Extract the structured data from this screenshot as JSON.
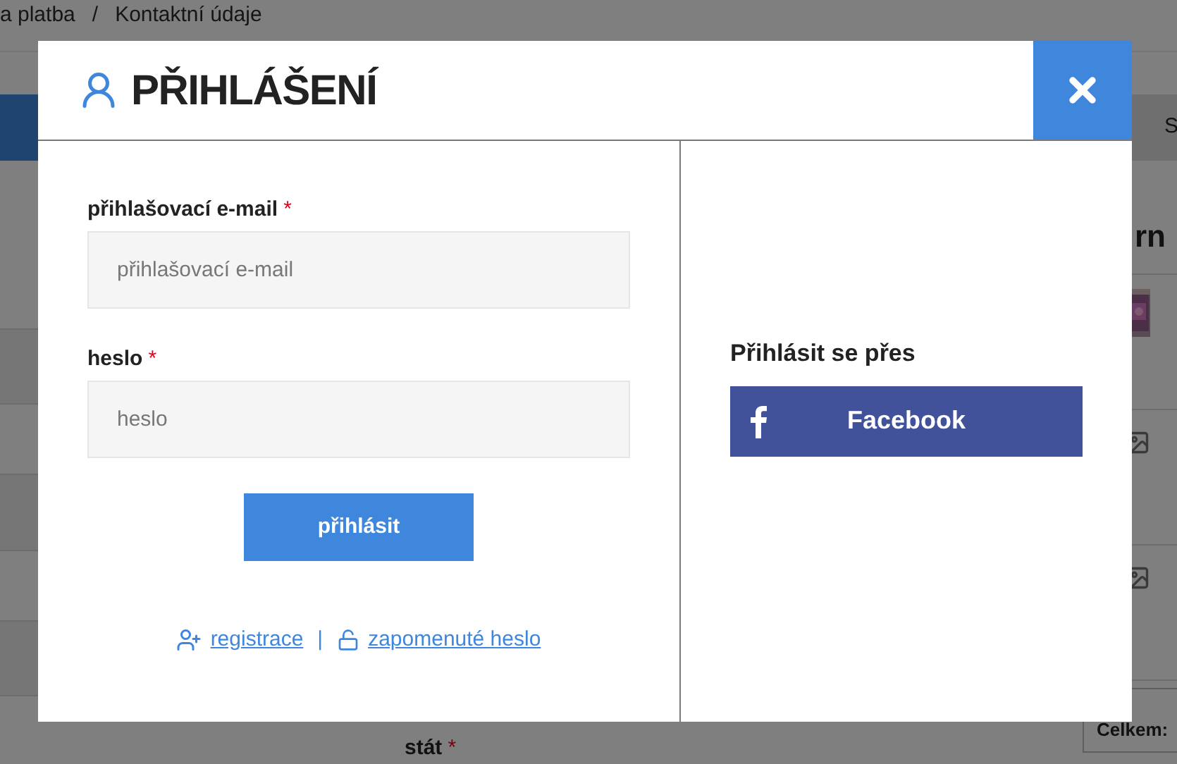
{
  "breadcrumb": {
    "items": [
      "a platba",
      "Kontaktní údaje"
    ],
    "separator": "/"
  },
  "background": {
    "tab_label": "S",
    "heading": "rn",
    "thumbnails": [
      {
        "kind": "picture"
      },
      {
        "kind": "placeholder"
      },
      {
        "kind": "placeholder"
      }
    ],
    "total_label": "Celkem:",
    "field": {
      "label": "stát",
      "required": true
    }
  },
  "modal": {
    "title": "PŘIHLÁŠENÍ",
    "required_mark": "*",
    "fields": [
      {
        "label": "přihlašovací e-mail",
        "required": true,
        "placeholder": "přihlašovací e-mail"
      },
      {
        "label": "heslo",
        "required": true,
        "placeholder": "heslo"
      }
    ],
    "submit": "přihlásit",
    "links": [
      {
        "kind": "register",
        "label": "registrace"
      },
      {
        "kind": "forgot",
        "label": "zapomenuté heslo"
      }
    ],
    "link_separator": "|",
    "social": {
      "heading": "Přihlásit se přes",
      "buttons": [
        {
          "kind": "facebook",
          "label": "Facebook"
        }
      ]
    }
  }
}
